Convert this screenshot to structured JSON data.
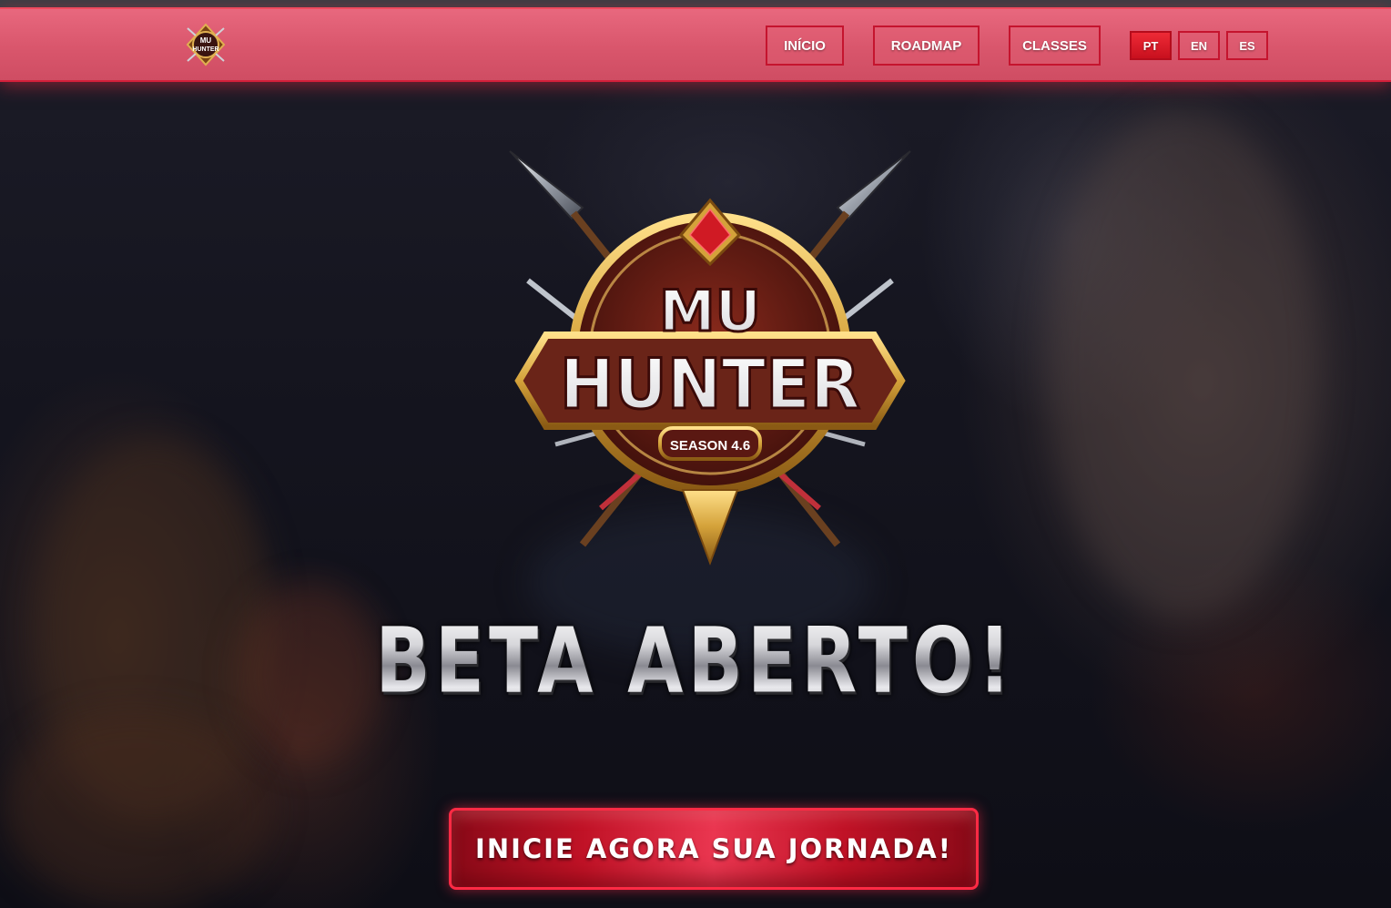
{
  "nav": {
    "logo_text_line1": "MU",
    "logo_text_line2": "HUNTER",
    "links": [
      {
        "label": "INÍCIO"
      },
      {
        "label": "ROADMAP"
      },
      {
        "label": "CLASSES"
      }
    ],
    "languages": [
      {
        "label": "PT",
        "active": true
      },
      {
        "label": "EN",
        "active": false
      },
      {
        "label": "ES",
        "active": false
      }
    ]
  },
  "hero": {
    "emblem": {
      "title_line1": "MU",
      "title_line2": "HUNTER",
      "season": "SEASON 4.6"
    },
    "headline": "BETA ABERTO!",
    "cta_label": "INICIE AGORA SUA JORNADA!"
  },
  "colors": {
    "navbar": "#d9566c",
    "accent_red": "#c5142e",
    "cta_red": "#c01226",
    "gold": "#d4a23a"
  }
}
